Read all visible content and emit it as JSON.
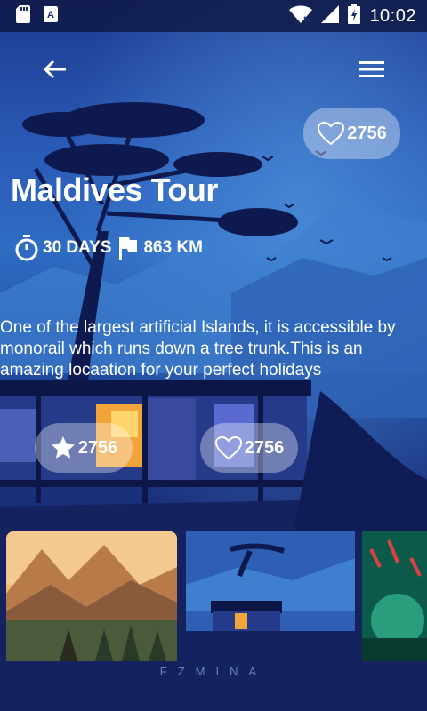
{
  "status_bar": {
    "time": "10:02"
  },
  "tour": {
    "title": "Maldives Tour",
    "likes": "2756",
    "duration": "30 DAYS",
    "distance": "863 KM",
    "description": "One of the largest artificial Islands, it is accessible by monorail which runs down a tree trunk.This is an amazing locaation for your perfect holidays",
    "rating_count": "2756",
    "favorite_count": "2756"
  },
  "brand": "FZMINA",
  "colors": {
    "accent": "#ffffff",
    "background": "#1d3a8f"
  },
  "icons": [
    "sd-card-icon",
    "app-notification-icon",
    "wifi-icon",
    "signal-icon",
    "battery-icon",
    "back-arrow-icon",
    "menu-icon",
    "heart-icon",
    "timer-icon",
    "flag-icon",
    "star-icon"
  ]
}
